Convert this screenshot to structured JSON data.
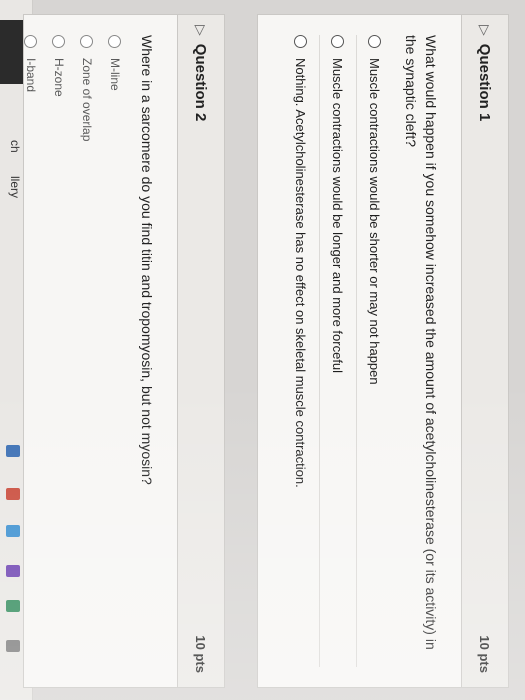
{
  "sidebar": {
    "items": [
      {
        "label": "ch"
      },
      {
        "label": "llery"
      }
    ]
  },
  "question1": {
    "title": "Question 1",
    "points": "10 pts",
    "prompt": "What would happen if you somehow increased the amount of acetylcholinesterase (or its activity) in the synaptic cleft?",
    "answers": [
      "Muscle contractions would be shorter or may not happen",
      "Muscle contractions would be longer and more forceful",
      "Nothing. Acetylcholinesterase has no effect on skeletal muscle contraction."
    ]
  },
  "question2": {
    "title": "Question 2",
    "points": "10 pts",
    "prompt": "Where in a sarcomere do you find titin and tropomyosin, but not myosin?",
    "answers": [
      "M-line",
      "Zone of overlap",
      "H-zone",
      "I-band"
    ]
  },
  "colors": {
    "card_bg": "#f7f6f4",
    "header_bg": "#ebe9e6",
    "sidebar_dark": "#2b2b2b"
  }
}
